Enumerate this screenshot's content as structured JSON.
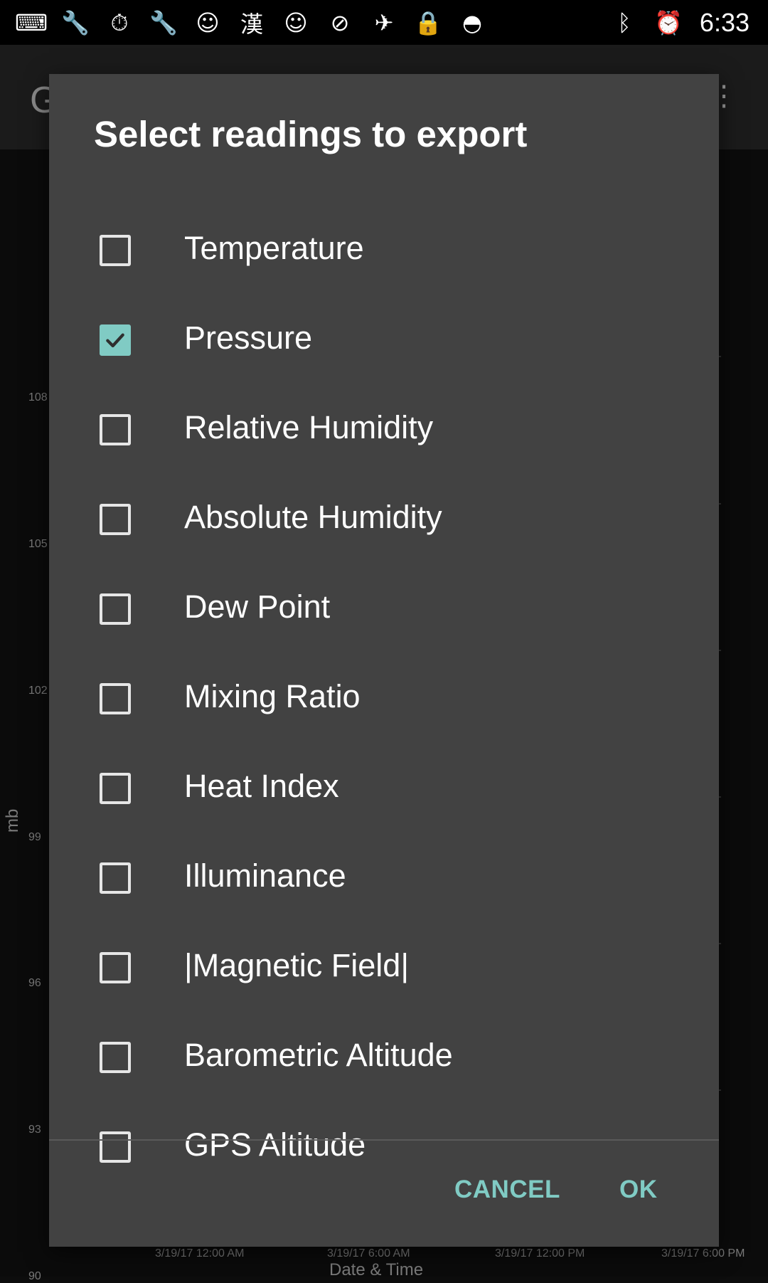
{
  "status_bar": {
    "left_icons": [
      "keyboard-icon",
      "wrench-icon",
      "stopwatch-icon",
      "wrench-icon",
      "smiley-icon",
      "chinese-input-icon",
      "smiley-icon",
      "block-icon",
      "satellite-icon",
      "lock-icon",
      "android-icon"
    ],
    "right_icons": [
      "bluetooth-icon",
      "alarm-icon"
    ],
    "time": "6:33"
  },
  "background": {
    "app_title": "G",
    "y_axis_label": "mb",
    "y_ticks": [
      "108",
      "105",
      "102",
      "99",
      "96",
      "93",
      "90"
    ],
    "x_ticks": [
      "3/19/17 12:00 AM",
      "3/19/17 6:00 AM",
      "3/19/17 12:00 PM",
      "3/19/17 6:00 PM"
    ],
    "x_axis_label": "Date & Time"
  },
  "dialog": {
    "title": "Select readings to export",
    "options": [
      {
        "label": "Temperature",
        "checked": false
      },
      {
        "label": "Pressure",
        "checked": true
      },
      {
        "label": "Relative Humidity",
        "checked": false
      },
      {
        "label": "Absolute Humidity",
        "checked": false
      },
      {
        "label": "Dew Point",
        "checked": false
      },
      {
        "label": "Mixing Ratio",
        "checked": false
      },
      {
        "label": "Heat Index",
        "checked": false
      },
      {
        "label": "Illuminance",
        "checked": false
      },
      {
        "label": "|Magnetic Field|",
        "checked": false
      },
      {
        "label": "Barometric Altitude",
        "checked": false
      },
      {
        "label": "GPS Altitude",
        "checked": false
      }
    ],
    "cancel_label": "CANCEL",
    "ok_label": "OK",
    "accent_color": "#80cbc4",
    "background_color": "#424242"
  }
}
